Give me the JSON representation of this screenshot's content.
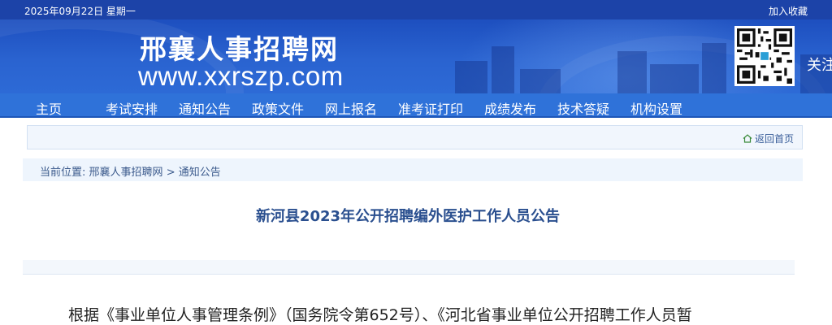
{
  "topbar": {
    "date": "2025年09月22日 星期一",
    "favorite": "加入收藏"
  },
  "header": {
    "site_name": "邢襄人事招聘网",
    "site_url": "www.xxrszp.com",
    "follow": "关注"
  },
  "nav": {
    "items": [
      "主页",
      "考试安排",
      "通知公告",
      "政策文件",
      "网上报名",
      "准考证打印",
      "成绩发布",
      "技术答疑",
      "机构设置"
    ]
  },
  "toolbar": {
    "back_home": "返回首页"
  },
  "breadcrumb": {
    "prefix": "当前位置:",
    "home": "邢襄人事招聘网",
    "separator": ">",
    "current": "通知公告"
  },
  "article": {
    "title": "新河县2023年公开招聘编外医护工作人员公告",
    "first_line": "根据《事业单位人事管理条例》（国务院令第652号）、《河北省事业单位公开招聘工作人员暂"
  },
  "colors": {
    "topbar": "#1c43a8",
    "nav": "#2f72d9",
    "title": "#2a4f8f"
  }
}
